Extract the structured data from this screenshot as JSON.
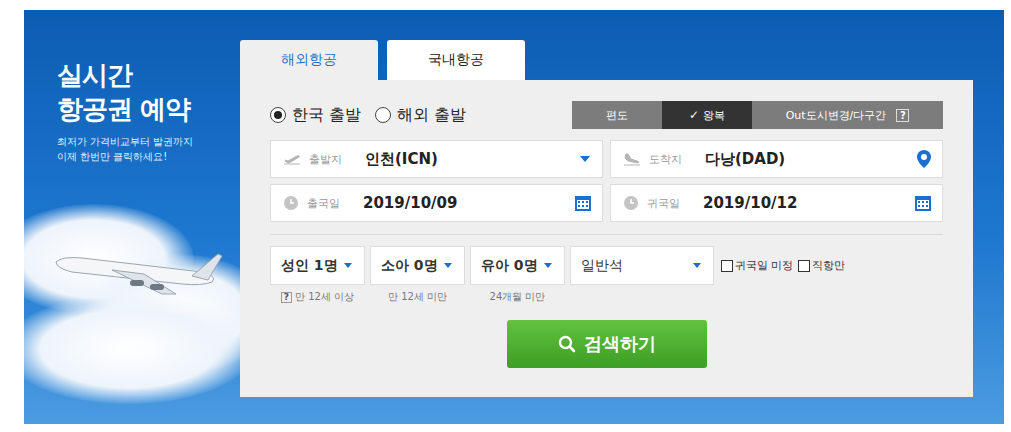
{
  "banner": {
    "title_lines": [
      "실시간",
      "항공권 예약"
    ],
    "subtitle_lines": [
      "최저가 가격비교부터 발권까지",
      "이제 한번만 클릭하세요!"
    ]
  },
  "tabs": [
    {
      "label": "해외항공",
      "selected": true
    },
    {
      "label": "국내항공",
      "selected": false
    }
  ],
  "origin_options": [
    {
      "label": "한국 출발",
      "selected": true
    },
    {
      "label": "해외 출발",
      "selected": false
    }
  ],
  "selected_mark": "✓",
  "trip_types": [
    {
      "label": "편도",
      "selected": false,
      "help": ""
    },
    {
      "label": "왕복",
      "selected": true,
      "help": ""
    },
    {
      "label": "Out도시변경/다구간",
      "selected": false,
      "help": "?"
    }
  ],
  "fields": [
    {
      "label": "출발지",
      "value": "인천(ICN)",
      "kind": "origin"
    },
    {
      "label": "도착지",
      "value": "다낭(DAD)",
      "kind": "destination"
    },
    {
      "label": "출국일",
      "value": "2019/10/09",
      "kind": "date"
    },
    {
      "label": "귀국일",
      "value": "2019/10/12",
      "kind": "date"
    }
  ],
  "passengers": [
    {
      "label": "성인 1명",
      "hint": "만 12세 이상"
    },
    {
      "label": "소아 0명",
      "hint": "만 12세 미만"
    },
    {
      "label": "유아 0명",
      "hint": "24개월 미만"
    }
  ],
  "hint_help": "?",
  "cabin": {
    "label": "일반석"
  },
  "checkboxes": [
    {
      "label": "귀국일 미정",
      "checked": false
    },
    {
      "label": "직항만",
      "checked": false
    }
  ],
  "search_button": {
    "label": "검색하기"
  }
}
